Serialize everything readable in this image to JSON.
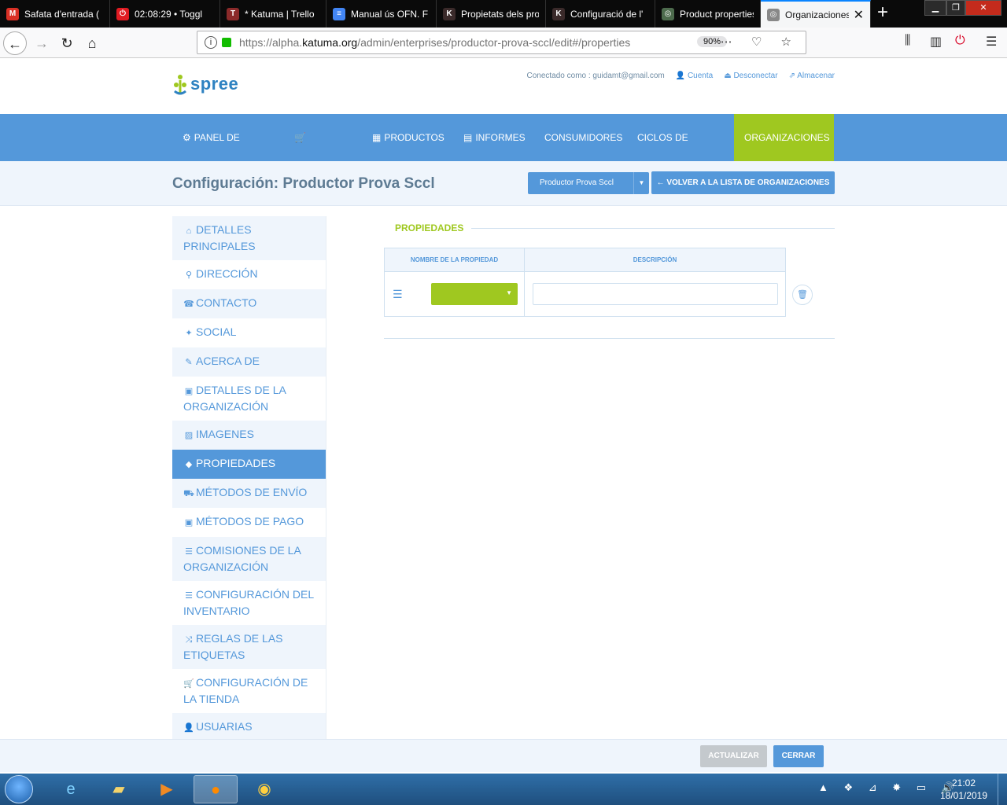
{
  "browser": {
    "tabs": [
      {
        "label": "Safata d'entrada (",
        "icon": "gmail-icon",
        "color": "#d93025",
        "glyph": "M"
      },
      {
        "label": "02:08:29 • Toggl",
        "icon": "toggl-icon",
        "color": "#e01b22",
        "glyph": "⏻"
      },
      {
        "label": "* Katuma | Trello",
        "icon": "trello-icon",
        "color": "#8b2a2a",
        "glyph": "T"
      },
      {
        "label": "Manual ús OFN. F",
        "icon": "docs-icon",
        "color": "#4285f4",
        "glyph": "≡"
      },
      {
        "label": "Propietats dels pro",
        "icon": "katuma-icon",
        "color": "#3a2a2a",
        "glyph": "K"
      },
      {
        "label": "Configuració de l'",
        "icon": "katuma-icon",
        "color": "#3a2a2a",
        "glyph": "K"
      },
      {
        "label": "Product properties",
        "icon": "ofn-icon",
        "color": "#4d6b4d",
        "glyph": "◎"
      },
      {
        "label": "Organizaciones",
        "icon": "ofn-icon",
        "color": "#888888",
        "glyph": "◎"
      }
    ],
    "url_prefix": "https://alpha.",
    "url_host": "katuma.org",
    "url_path": "/admin/enterprises/productor-prova-sccl/edit#/properties",
    "zoom": "90%"
  },
  "header": {
    "logo_text": "spree",
    "logged_in_as": "Conectado como : guidamt@gmail.com",
    "account": "Cuenta",
    "logout": "Desconectar",
    "store": "Almacenar"
  },
  "mainnav": {
    "items": [
      {
        "label": "Panel de inicio",
        "icon": "⚙"
      },
      {
        "label": "Pedidos",
        "icon": "🛒"
      },
      {
        "label": "Productos",
        "icon": "▦"
      },
      {
        "label": "Informes",
        "icon": "▤"
      },
      {
        "label": "Consumidores",
        "icon": ""
      },
      {
        "label": "Ciclos de pedidos",
        "icon": ""
      },
      {
        "label": "Organizaciones",
        "icon": ""
      }
    ],
    "active_index": 6
  },
  "page": {
    "title": "Configuración: Productor Prova Sccl",
    "enterprise_select": "Productor Prova Sccl",
    "back_button": "Volver a la lista de organizaciones"
  },
  "sidebar": {
    "items": [
      {
        "label": "Detalles principales",
        "icon": "⌂"
      },
      {
        "label": "Dirección",
        "icon": "⚲"
      },
      {
        "label": "Contacto",
        "icon": "☎"
      },
      {
        "label": "Social",
        "icon": "✦"
      },
      {
        "label": "Acerca de",
        "icon": "✎"
      },
      {
        "label": "Detalles de la organización",
        "icon": "▣"
      },
      {
        "label": "Imagenes",
        "icon": "▨"
      },
      {
        "label": "Propiedades",
        "icon": "◆"
      },
      {
        "label": "Métodos de envío",
        "icon": "⛟"
      },
      {
        "label": "Métodos de pago",
        "icon": "▣"
      },
      {
        "label": "Comisiones de la organización",
        "icon": "☰"
      },
      {
        "label": "Configuración del inventario",
        "icon": "☰"
      },
      {
        "label": "Reglas de las etiquetas",
        "icon": "⤨"
      },
      {
        "label": "Configuración de la tienda",
        "icon": "🛒"
      },
      {
        "label": "Usuarias",
        "icon": "👤"
      }
    ],
    "active_index": 7
  },
  "properties": {
    "section_title": "Propiedades",
    "col_name": "Nombre de la propiedad",
    "col_description": "Descripción",
    "row": {
      "name_value": "",
      "description_value": ""
    }
  },
  "footer": {
    "update": "Actualizar",
    "close": "Cerrar"
  },
  "taskbar": {
    "time": "21:02",
    "date": "18/01/2019"
  },
  "colors": {
    "primary": "#5498da",
    "accent": "#9fc820",
    "light_bg": "#eff5fc"
  }
}
